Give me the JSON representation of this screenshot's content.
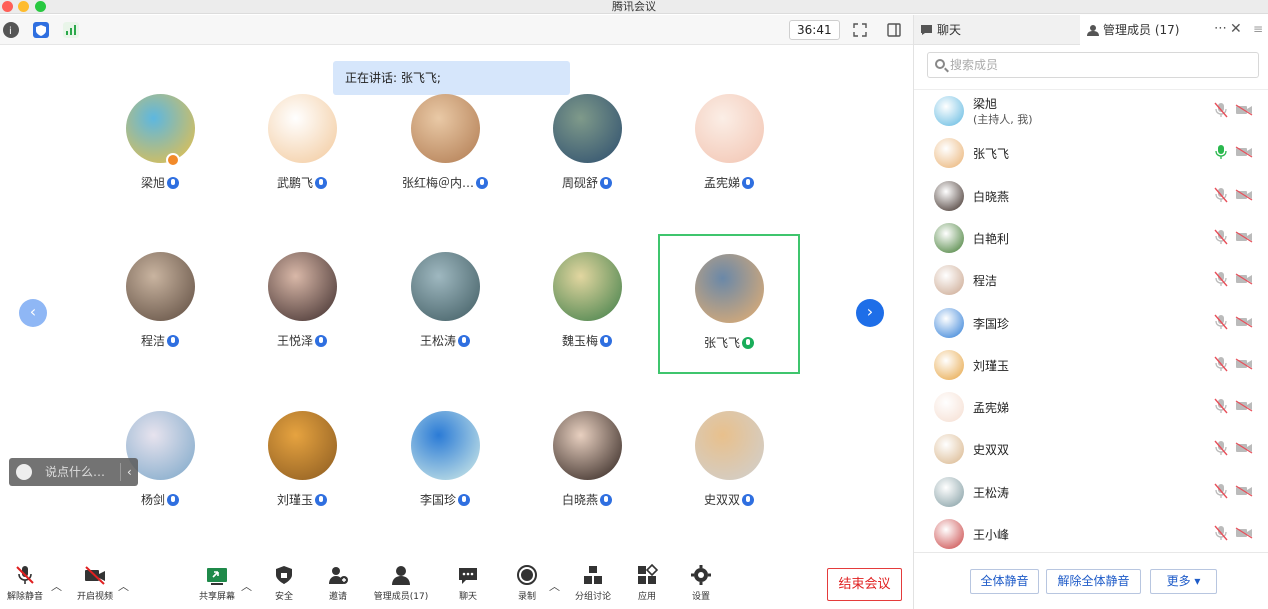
{
  "window": {
    "title": "腾讯会议"
  },
  "toolbar": {
    "timer": "36:41"
  },
  "stage": {
    "speaking_banner": "正在讲话: 张飞飞;",
    "tiles": [
      {
        "name": "梁旭",
        "c1": "#5db7e0",
        "c2": "#f0c040",
        "host": true
      },
      {
        "name": "武鹏飞",
        "c1": "#ffffff",
        "c2": "#f2c89a"
      },
      {
        "name": "张红梅＠内…",
        "c1": "#e9c9a6",
        "c2": "#b07a50"
      },
      {
        "name": "周砚舒",
        "c1": "#7f9a8a",
        "c2": "#2c4d6e"
      },
      {
        "name": "孟宪娣",
        "c1": "#fbeee6",
        "c2": "#f2c3b0"
      },
      {
        "name": "程洁",
        "c1": "#c9b4a0",
        "c2": "#5c4a3e"
      },
      {
        "name": "王悦泽",
        "c1": "#d9b8a8",
        "c2": "#3b2a2a"
      },
      {
        "name": "王松涛",
        "c1": "#9fb8c0",
        "c2": "#3e5a60"
      },
      {
        "name": "魏玉梅",
        "c1": "#e2d6a0",
        "c2": "#3b7c46"
      },
      {
        "name": "张飞飞",
        "c1": "#6a88a8",
        "c2": "#e9b070",
        "active": true
      },
      {
        "name": "杨剑",
        "c1": "#e7e3ee",
        "c2": "#7aa6c8"
      },
      {
        "name": "刘瑾玉",
        "c1": "#e6a340",
        "c2": "#8a5a20"
      },
      {
        "name": "李国珍",
        "c1": "#2b7bd6",
        "c2": "#d7efe8"
      },
      {
        "name": "白晓燕",
        "c1": "#e8d0c0",
        "c2": "#2a1e1a"
      },
      {
        "name": "史双双",
        "c1": "#e8c08c",
        "c2": "#d0d0d0"
      }
    ],
    "chat_placeholder": "说点什么…"
  },
  "bottom": {
    "unmute": "解除静音",
    "video": "开启视频",
    "share": "共享屏幕",
    "security": "安全",
    "invite": "邀请",
    "manage": "管理成员(17)",
    "chat": "聊天",
    "record": "录制",
    "breakout": "分组讨论",
    "apps": "应用",
    "settings": "设置",
    "end": "结束会议"
  },
  "panel": {
    "tab_chat": "聊天",
    "tab_members": "管理成员 (17)",
    "search_placeholder": "搜索成员",
    "members": [
      {
        "name": "梁旭",
        "sub": "(主持人, 我)",
        "color": "#5db7e0",
        "mic": "muted"
      },
      {
        "name": "张飞飞",
        "sub": "",
        "color": "#e9b070",
        "mic": "on"
      },
      {
        "name": "白晓燕",
        "sub": "",
        "color": "#3a2a24",
        "mic": "muted"
      },
      {
        "name": "白艳利",
        "sub": "",
        "color": "#3f7a30",
        "mic": "muted"
      },
      {
        "name": "程洁",
        "sub": "",
        "color": "#c9a48c",
        "mic": "muted"
      },
      {
        "name": "李国珍",
        "sub": "",
        "color": "#2b7bd6",
        "mic": "muted"
      },
      {
        "name": "刘瑾玉",
        "sub": "",
        "color": "#e6a340",
        "mic": "muted"
      },
      {
        "name": "孟宪娣",
        "sub": "",
        "color": "#f5ddd0",
        "mic": "muted"
      },
      {
        "name": "史双双",
        "sub": "",
        "color": "#d8b489",
        "mic": "muted"
      },
      {
        "name": "王松涛",
        "sub": "",
        "color": "#7e9aa0",
        "mic": "muted"
      },
      {
        "name": "王小峰",
        "sub": "",
        "color": "#c84040",
        "mic": "muted"
      }
    ],
    "btn_mute_all": "全体静音",
    "btn_unmute_all": "解除全体静音",
    "btn_more": "更多 ▾"
  }
}
